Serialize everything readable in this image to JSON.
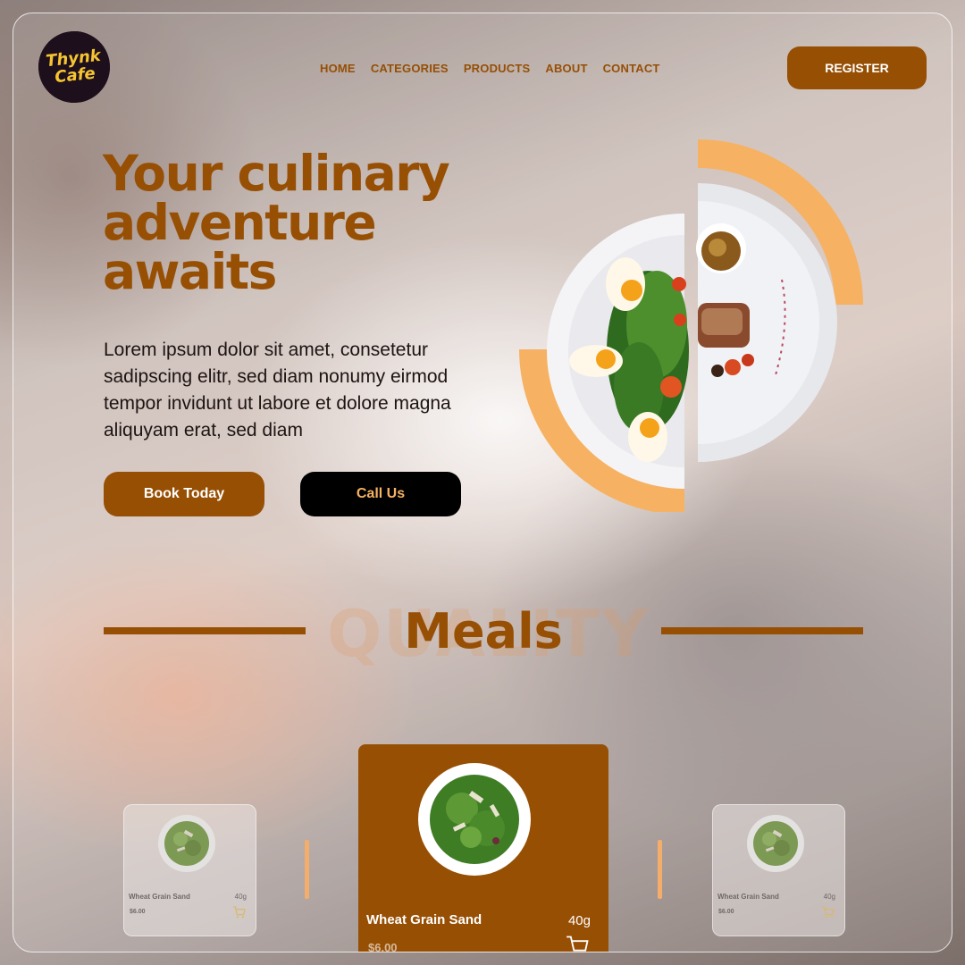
{
  "brand": {
    "logo_line1": "Thynk",
    "logo_line2": "Cafe"
  },
  "nav": {
    "items": [
      "HOME",
      "CATEGORIES",
      "PRODUCTS",
      "ABOUT",
      "CONTACT"
    ],
    "register_label": "REGISTER"
  },
  "hero": {
    "title": "Your culinary adventure awaits",
    "text": "Lorem ipsum dolor sit amet, consetetur sadipscing elitr, sed diam nonumy eirmod tempor invidunt ut labore et dolore magna aliquyam erat, sed diam",
    "book_label": "Book Today",
    "call_label": "Call Us"
  },
  "section": {
    "background_word": "QUALITY",
    "title": "Meals"
  },
  "cards": [
    {
      "name": "Wheat Grain Sand",
      "weight": "40g",
      "price": "$6.00"
    },
    {
      "name": "Wheat Grain Sand",
      "weight": "40g",
      "price": "$6.00"
    },
    {
      "name": "Wheat Grain Sand",
      "weight": "40g",
      "price": "$6.00"
    }
  ],
  "colors": {
    "brand_brown": "#974f04",
    "accent_orange": "#f6b262",
    "logo_yellow": "#f5c531"
  },
  "icons": {
    "cart": "shopping-cart-icon"
  }
}
